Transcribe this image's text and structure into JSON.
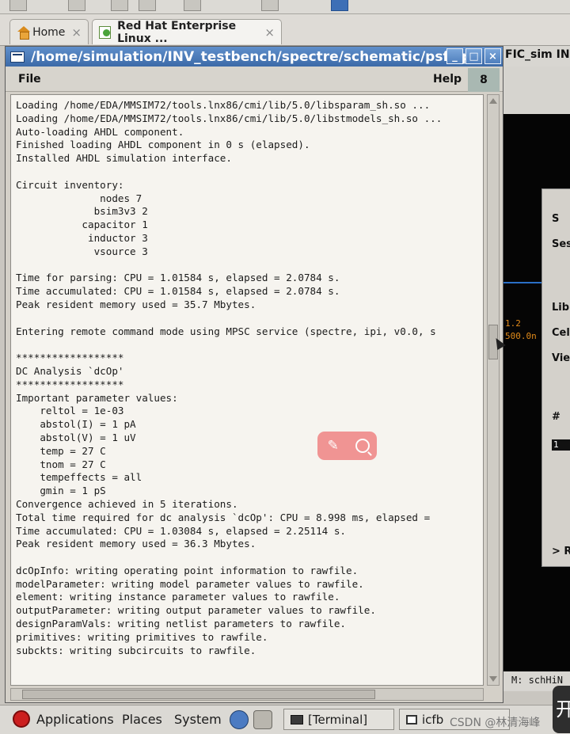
{
  "browser": {
    "tabs": [
      {
        "label": "Home",
        "close": "×"
      },
      {
        "label": "Red Hat Enterprise Linux ...",
        "close": "×"
      }
    ]
  },
  "background_window": {
    "title_fragment": "FIC_sim IN",
    "canvas_labels": [
      "1.2",
      "500.0n"
    ],
    "dialog_labels": [
      "S",
      "Ses",
      "Libr",
      "Cell",
      "View",
      "#",
      "1",
      "> R"
    ],
    "status": "M: schHiN"
  },
  "terminal_window": {
    "title": "/home/simulation/INV_testbench/spectre/schematic/psf/sp",
    "controls": {
      "minimize": "_",
      "maximize": "□",
      "close": "×"
    },
    "menu": {
      "file": "File",
      "help": "Help",
      "badge": "8"
    },
    "lines": [
      "Loading /home/EDA/MMSIM72/tools.lnx86/cmi/lib/5.0/libsparam_sh.so ...",
      "Loading /home/EDA/MMSIM72/tools.lnx86/cmi/lib/5.0/libstmodels_sh.so ...",
      "Auto-loading AHDL component.",
      "Finished loading AHDL component in 0 s (elapsed).",
      "Installed AHDL simulation interface.",
      "",
      "Circuit inventory:",
      "              nodes 7",
      "             bsim3v3 2",
      "           capacitor 1",
      "            inductor 3",
      "             vsource 3",
      "",
      "Time for parsing: CPU = 1.01584 s, elapsed = 2.0784 s.",
      "Time accumulated: CPU = 1.01584 s, elapsed = 2.0784 s.",
      "Peak resident memory used = 35.7 Mbytes.",
      "",
      "Entering remote command mode using MPSC service (spectre, ipi, v0.0, s",
      "",
      "******************",
      "DC Analysis `dcOp'",
      "******************",
      "Important parameter values:",
      "    reltol = 1e-03",
      "    abstol(I) = 1 pA",
      "    abstol(V) = 1 uV",
      "    temp = 27 C",
      "    tnom = 27 C",
      "    tempeffects = all",
      "    gmin = 1 pS",
      "Convergence achieved in 5 iterations.",
      "Total time required for dc analysis `dcOp': CPU = 8.998 ms, elapsed =",
      "Time accumulated: CPU = 1.03084 s, elapsed = 2.25114 s.",
      "Peak resident memory used = 36.3 Mbytes.",
      "",
      "dcOpInfo: writing operating point information to rawfile.",
      "modelParameter: writing model parameter values to rawfile.",
      "element: writing instance parameter values to rawfile.",
      "outputParameter: writing output parameter values to rawfile.",
      "designParamVals: writing netlist parameters to rawfile.",
      "primitives: writing primitives to rawfile.",
      "subckts: writing subcircuits to rawfile."
    ]
  },
  "taskbar": {
    "applications": "Applications",
    "places": "Places",
    "system": "System",
    "task_terminal": "[Terminal]",
    "task_icfb": "icfb",
    "watermark": "CSDN @林清海峰",
    "corner": "开"
  },
  "colors": {
    "title_bar": "#3c6aa8",
    "console_bg": "#f6f4ef",
    "overlay": "#f08c8c",
    "schematic_bg": "#050505"
  },
  "icons": [
    "home-icon",
    "redhat-page-icon",
    "window-menu-icon",
    "magic-wand-icon",
    "search-icon",
    "redhat-logo-icon",
    "network-icon",
    "terminal-icon"
  ]
}
